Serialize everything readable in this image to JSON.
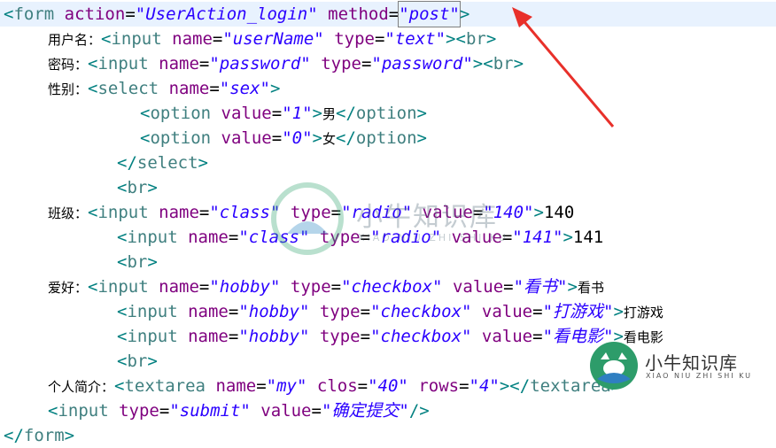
{
  "lines": [
    {
      "tokens": [
        [
          "bracket",
          "<"
        ],
        [
          "tag",
          "form"
        ],
        [
          "t",
          " "
        ],
        [
          "attr",
          "action"
        ],
        [
          "eq",
          "="
        ],
        [
          "val",
          "\"UserAction_login\""
        ],
        [
          "t",
          " "
        ],
        [
          "attr",
          "method"
        ],
        [
          "eq",
          "="
        ],
        [
          "valbox",
          "\"post\""
        ],
        [
          "bracket",
          ">"
        ]
      ]
    },
    {
      "tokens": [
        [
          "label",
          "用户名："
        ],
        [
          "bracket",
          "<"
        ],
        [
          "tag",
          "input"
        ],
        [
          "t",
          " "
        ],
        [
          "attr",
          "name"
        ],
        [
          "eq",
          "="
        ],
        [
          "val",
          "\"userName\""
        ],
        [
          "t",
          " "
        ],
        [
          "attr",
          "type"
        ],
        [
          "eq",
          "="
        ],
        [
          "val",
          "\"text\""
        ],
        [
          "bracket",
          "><"
        ],
        [
          "tag",
          "br"
        ],
        [
          "bracket",
          ">"
        ]
      ]
    },
    {
      "tokens": [
        [
          "label",
          "密码："
        ],
        [
          "bracket",
          "<"
        ],
        [
          "tag",
          "input"
        ],
        [
          "t",
          " "
        ],
        [
          "attr",
          "name"
        ],
        [
          "eq",
          "="
        ],
        [
          "val",
          "\"password\""
        ],
        [
          "t",
          " "
        ],
        [
          "attr",
          "type"
        ],
        [
          "eq",
          "="
        ],
        [
          "val",
          "\"password\""
        ],
        [
          "bracket",
          "><"
        ],
        [
          "tag",
          "br"
        ],
        [
          "bracket",
          ">"
        ]
      ]
    },
    {
      "tokens": [
        [
          "label",
          "性别："
        ],
        [
          "bracket",
          "<"
        ],
        [
          "tag",
          "select"
        ],
        [
          "t",
          " "
        ],
        [
          "attr",
          "name"
        ],
        [
          "eq",
          "="
        ],
        [
          "val",
          "\"sex\""
        ],
        [
          "bracket",
          ">"
        ]
      ]
    },
    {
      "tokens": [
        [
          "bracket",
          "<"
        ],
        [
          "tag",
          "option"
        ],
        [
          "t",
          " "
        ],
        [
          "attr",
          "value"
        ],
        [
          "eq",
          "="
        ],
        [
          "val",
          "\"1\""
        ],
        [
          "bracket",
          ">"
        ],
        [
          "label",
          "男"
        ],
        [
          "bracket",
          "</"
        ],
        [
          "tag",
          "option"
        ],
        [
          "bracket",
          ">"
        ]
      ]
    },
    {
      "tokens": [
        [
          "bracket",
          "<"
        ],
        [
          "tag",
          "option"
        ],
        [
          "t",
          " "
        ],
        [
          "attr",
          "value"
        ],
        [
          "eq",
          "="
        ],
        [
          "val",
          "\"0\""
        ],
        [
          "bracket",
          ">"
        ],
        [
          "label",
          "女"
        ],
        [
          "bracket",
          "</"
        ],
        [
          "tag",
          "option"
        ],
        [
          "bracket",
          ">"
        ]
      ]
    },
    {
      "tokens": [
        [
          "bracket",
          "</"
        ],
        [
          "tag",
          "select"
        ],
        [
          "bracket",
          ">"
        ]
      ]
    },
    {
      "tokens": [
        [
          "bracket",
          "<"
        ],
        [
          "tag",
          "br"
        ],
        [
          "bracket",
          ">"
        ]
      ]
    },
    {
      "tokens": [
        [
          "label",
          "班级："
        ],
        [
          "bracket",
          "<"
        ],
        [
          "tag",
          "input"
        ],
        [
          "t",
          " "
        ],
        [
          "attr",
          "name"
        ],
        [
          "eq",
          "="
        ],
        [
          "val",
          "\"class\""
        ],
        [
          "t",
          " "
        ],
        [
          "attr",
          "type"
        ],
        [
          "eq",
          "="
        ],
        [
          "val",
          "\"radio\""
        ],
        [
          "t",
          " "
        ],
        [
          "attr",
          "value"
        ],
        [
          "eq",
          "="
        ],
        [
          "val",
          "\"140\""
        ],
        [
          "bracket",
          ">"
        ],
        [
          "t",
          "140"
        ]
      ]
    },
    {
      "tokens": [
        [
          "bracket",
          "<"
        ],
        [
          "tag",
          "input"
        ],
        [
          "t",
          " "
        ],
        [
          "attr",
          "name"
        ],
        [
          "eq",
          "="
        ],
        [
          "val",
          "\"class\""
        ],
        [
          "t",
          " "
        ],
        [
          "attr",
          "type"
        ],
        [
          "eq",
          "="
        ],
        [
          "val",
          "\"radio\""
        ],
        [
          "t",
          " "
        ],
        [
          "attr",
          "value"
        ],
        [
          "eq",
          "="
        ],
        [
          "val",
          "\"141\""
        ],
        [
          "bracket",
          ">"
        ],
        [
          "t",
          "141"
        ]
      ]
    },
    {
      "tokens": [
        [
          "bracket",
          "<"
        ],
        [
          "tag",
          "br"
        ],
        [
          "bracket",
          ">"
        ]
      ]
    },
    {
      "tokens": [
        [
          "label",
          "爱好："
        ],
        [
          "bracket",
          "<"
        ],
        [
          "tag",
          "input"
        ],
        [
          "t",
          " "
        ],
        [
          "attr",
          "name"
        ],
        [
          "eq",
          "="
        ],
        [
          "val",
          "\"hobby\""
        ],
        [
          "t",
          " "
        ],
        [
          "attr",
          "type"
        ],
        [
          "eq",
          "="
        ],
        [
          "val",
          "\"checkbox\""
        ],
        [
          "t",
          " "
        ],
        [
          "attr",
          "value"
        ],
        [
          "eq",
          "="
        ],
        [
          "val",
          "\"看书\""
        ],
        [
          "bracket",
          ">"
        ],
        [
          "label",
          "看书"
        ]
      ]
    },
    {
      "tokens": [
        [
          "bracket",
          "<"
        ],
        [
          "tag",
          "input"
        ],
        [
          "t",
          " "
        ],
        [
          "attr",
          "name"
        ],
        [
          "eq",
          "="
        ],
        [
          "val",
          "\"hobby\""
        ],
        [
          "t",
          " "
        ],
        [
          "attr",
          "type"
        ],
        [
          "eq",
          "="
        ],
        [
          "val",
          "\"checkbox\""
        ],
        [
          "t",
          " "
        ],
        [
          "attr",
          "value"
        ],
        [
          "eq",
          "="
        ],
        [
          "val",
          "\"打游戏\""
        ],
        [
          "bracket",
          ">"
        ],
        [
          "label",
          "打游戏"
        ]
      ]
    },
    {
      "tokens": [
        [
          "bracket",
          "<"
        ],
        [
          "tag",
          "input"
        ],
        [
          "t",
          " "
        ],
        [
          "attr",
          "name"
        ],
        [
          "eq",
          "="
        ],
        [
          "val",
          "\"hobby\""
        ],
        [
          "t",
          " "
        ],
        [
          "attr",
          "type"
        ],
        [
          "eq",
          "="
        ],
        [
          "val",
          "\"checkbox\""
        ],
        [
          "t",
          " "
        ],
        [
          "attr",
          "value"
        ],
        [
          "eq",
          "="
        ],
        [
          "val",
          "\"看电影\""
        ],
        [
          "bracket",
          ">"
        ],
        [
          "label",
          "看电影"
        ]
      ]
    },
    {
      "tokens": [
        [
          "bracket",
          "<"
        ],
        [
          "tag",
          "br"
        ],
        [
          "bracket",
          ">"
        ]
      ]
    },
    {
      "tokens": [
        [
          "label",
          "个人简介："
        ],
        [
          "bracket",
          "<"
        ],
        [
          "tag",
          "textarea"
        ],
        [
          "t",
          " "
        ],
        [
          "attr",
          "name"
        ],
        [
          "eq",
          "="
        ],
        [
          "val",
          "\"my\""
        ],
        [
          "t",
          " "
        ],
        [
          "attr",
          "clos"
        ],
        [
          "eq",
          "="
        ],
        [
          "val",
          "\"40\""
        ],
        [
          "t",
          " "
        ],
        [
          "attr",
          "rows"
        ],
        [
          "eq",
          "="
        ],
        [
          "val",
          "\"4\""
        ],
        [
          "bracket",
          "></"
        ],
        [
          "tag",
          "textarea"
        ],
        [
          "bracket",
          ">"
        ]
      ]
    },
    {
      "tokens": [
        [
          "bracket",
          "<"
        ],
        [
          "tag",
          "input"
        ],
        [
          "t",
          " "
        ],
        [
          "attr",
          "type"
        ],
        [
          "eq",
          "="
        ],
        [
          "val",
          "\"submit\""
        ],
        [
          "t",
          " "
        ],
        [
          "attr",
          "value"
        ],
        [
          "eq",
          "="
        ],
        [
          "val",
          "\"确定提交\""
        ],
        [
          "bracket",
          "/>"
        ]
      ]
    },
    {
      "tokens": [
        [
          "bracket",
          "</"
        ],
        [
          "tag",
          "form"
        ],
        [
          "bracket",
          ">"
        ]
      ]
    }
  ],
  "watermark": {
    "brand_cn": "小牛知识库",
    "brand_pinyin": "XIAO NIU ZHI SHI KU"
  },
  "colors": {
    "tag": "#3f7f7f",
    "attr": "#7f007f",
    "value": "#2a00ff",
    "arrow": "#e8302a",
    "highlight": "#e8f2fe"
  }
}
